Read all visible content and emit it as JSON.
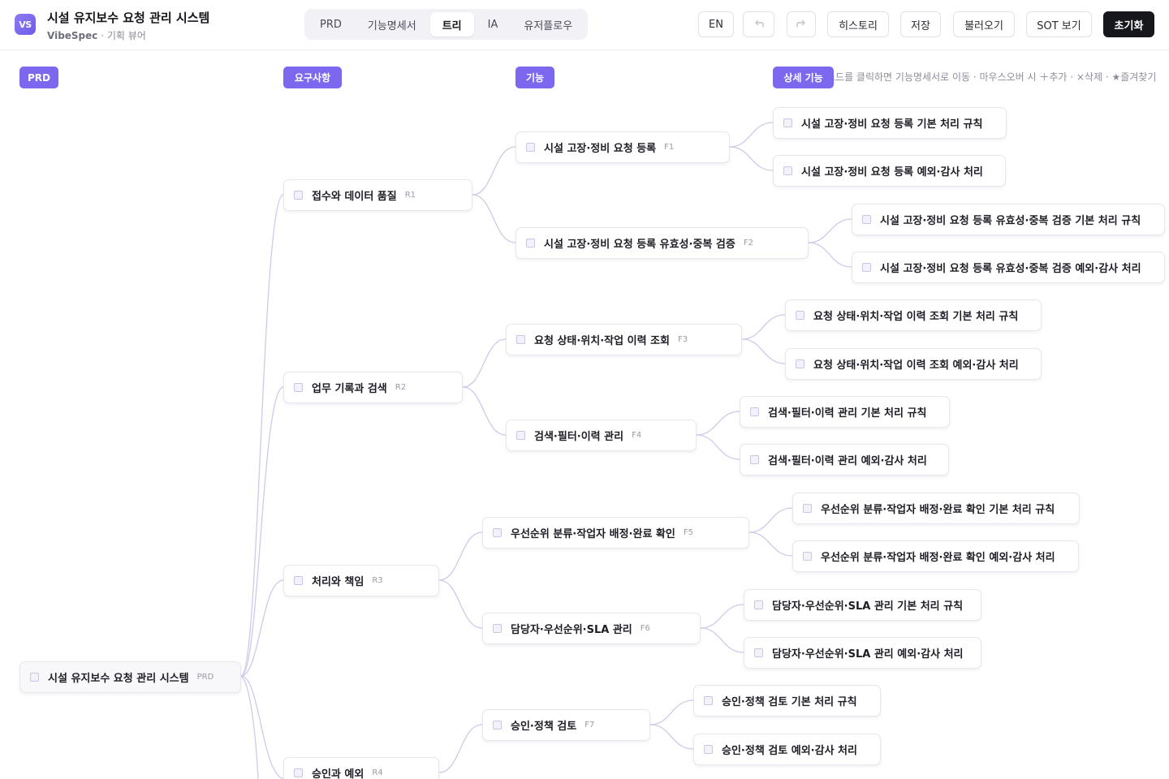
{
  "header": {
    "logo_text": "VS",
    "title": "시설 유지보수 요청 관리 시스템",
    "brand": "VibeSpec",
    "subtitle_suffix": " · 기획 뷰어",
    "tabs": [
      "PRD",
      "기능명세서",
      "트리",
      "IA",
      "유저플로우"
    ],
    "active_tab": "트리",
    "lang_label": "EN",
    "undo_icon": "undo-icon",
    "redo_icon": "redo-icon",
    "history_label": "히스토리",
    "save_label": "저장",
    "load_label": "불러오기",
    "sot_label": "SOT 보기",
    "reset_label": "초기화"
  },
  "tree": {
    "columns": [
      "PRD",
      "요구사항",
      "기능",
      "상세 기능"
    ],
    "hint": "노드를 클릭하면 기능명세서로 이동 · 마우스오버 시 ＋추가 · ×삭제 · ★즐겨찾기",
    "root": {
      "label": "시설 유지보수 요청 관리 시스템",
      "id": "PRD"
    },
    "requirements": [
      {
        "label": "접수와 데이터 품질",
        "id": "R1"
      },
      {
        "label": "업무 기록과 검색",
        "id": "R2"
      },
      {
        "label": "처리와 책임",
        "id": "R3"
      },
      {
        "label": "승인과 예외",
        "id": "R4"
      }
    ],
    "features": [
      {
        "label": "시설 고장·정비 요청 등록",
        "id": "F1"
      },
      {
        "label": "시설 고장·정비 요청 등록 유효성·중복 검증",
        "id": "F2"
      },
      {
        "label": "요청 상태·위치·작업 이력 조회",
        "id": "F3"
      },
      {
        "label": "검색·필터·이력 관리",
        "id": "F4"
      },
      {
        "label": "우선순위 분류·작업자 배정·완료 확인",
        "id": "F5"
      },
      {
        "label": "담당자·우선순위·SLA 관리",
        "id": "F6"
      },
      {
        "label": "승인·정책 검토",
        "id": "F7"
      }
    ],
    "details": [
      "시설 고장·정비 요청 등록 기본 처리 규칙",
      "시설 고장·정비 요청 등록 예외·감사 처리",
      "시설 고장·정비 요청 등록 유효성·중복 검증 기본 처리 규칙",
      "시설 고장·정비 요청 등록 유효성·중복 검증 예외·감사 처리",
      "요청 상태·위치·작업 이력 조회 기본 처리 규칙",
      "요청 상태·위치·작업 이력 조회 예외·감사 처리",
      "검색·필터·이력 관리 기본 처리 규칙",
      "검색·필터·이력 관리 예외·감사 처리",
      "우선순위 분류·작업자 배정·완료 확인 기본 처리 규칙",
      "우선순위 분류·작업자 배정·완료 확인 예외·감사 처리",
      "담당자·우선순위·SLA 관리 기본 처리 규칙",
      "담당자·우선순위·SLA 관리 예외·감사 처리",
      "승인·정책 검토 기본 처리 규칙",
      "승인·정책 검토 예외·감사 처리"
    ]
  }
}
